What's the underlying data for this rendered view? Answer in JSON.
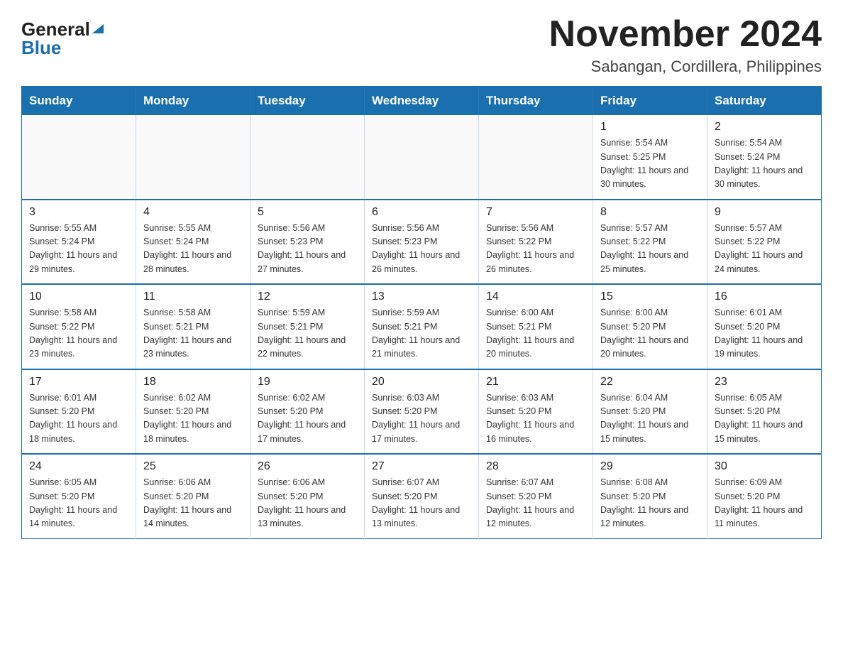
{
  "logo": {
    "general": "General",
    "blue": "Blue"
  },
  "header": {
    "month_year": "November 2024",
    "location": "Sabangan, Cordillera, Philippines"
  },
  "days_of_week": [
    "Sunday",
    "Monday",
    "Tuesday",
    "Wednesday",
    "Thursday",
    "Friday",
    "Saturday"
  ],
  "weeks": [
    [
      {
        "day": "",
        "info": ""
      },
      {
        "day": "",
        "info": ""
      },
      {
        "day": "",
        "info": ""
      },
      {
        "day": "",
        "info": ""
      },
      {
        "day": "",
        "info": ""
      },
      {
        "day": "1",
        "info": "Sunrise: 5:54 AM\nSunset: 5:25 PM\nDaylight: 11 hours and 30 minutes."
      },
      {
        "day": "2",
        "info": "Sunrise: 5:54 AM\nSunset: 5:24 PM\nDaylight: 11 hours and 30 minutes."
      }
    ],
    [
      {
        "day": "3",
        "info": "Sunrise: 5:55 AM\nSunset: 5:24 PM\nDaylight: 11 hours and 29 minutes."
      },
      {
        "day": "4",
        "info": "Sunrise: 5:55 AM\nSunset: 5:24 PM\nDaylight: 11 hours and 28 minutes."
      },
      {
        "day": "5",
        "info": "Sunrise: 5:56 AM\nSunset: 5:23 PM\nDaylight: 11 hours and 27 minutes."
      },
      {
        "day": "6",
        "info": "Sunrise: 5:56 AM\nSunset: 5:23 PM\nDaylight: 11 hours and 26 minutes."
      },
      {
        "day": "7",
        "info": "Sunrise: 5:56 AM\nSunset: 5:22 PM\nDaylight: 11 hours and 26 minutes."
      },
      {
        "day": "8",
        "info": "Sunrise: 5:57 AM\nSunset: 5:22 PM\nDaylight: 11 hours and 25 minutes."
      },
      {
        "day": "9",
        "info": "Sunrise: 5:57 AM\nSunset: 5:22 PM\nDaylight: 11 hours and 24 minutes."
      }
    ],
    [
      {
        "day": "10",
        "info": "Sunrise: 5:58 AM\nSunset: 5:22 PM\nDaylight: 11 hours and 23 minutes."
      },
      {
        "day": "11",
        "info": "Sunrise: 5:58 AM\nSunset: 5:21 PM\nDaylight: 11 hours and 23 minutes."
      },
      {
        "day": "12",
        "info": "Sunrise: 5:59 AM\nSunset: 5:21 PM\nDaylight: 11 hours and 22 minutes."
      },
      {
        "day": "13",
        "info": "Sunrise: 5:59 AM\nSunset: 5:21 PM\nDaylight: 11 hours and 21 minutes."
      },
      {
        "day": "14",
        "info": "Sunrise: 6:00 AM\nSunset: 5:21 PM\nDaylight: 11 hours and 20 minutes."
      },
      {
        "day": "15",
        "info": "Sunrise: 6:00 AM\nSunset: 5:20 PM\nDaylight: 11 hours and 20 minutes."
      },
      {
        "day": "16",
        "info": "Sunrise: 6:01 AM\nSunset: 5:20 PM\nDaylight: 11 hours and 19 minutes."
      }
    ],
    [
      {
        "day": "17",
        "info": "Sunrise: 6:01 AM\nSunset: 5:20 PM\nDaylight: 11 hours and 18 minutes."
      },
      {
        "day": "18",
        "info": "Sunrise: 6:02 AM\nSunset: 5:20 PM\nDaylight: 11 hours and 18 minutes."
      },
      {
        "day": "19",
        "info": "Sunrise: 6:02 AM\nSunset: 5:20 PM\nDaylight: 11 hours and 17 minutes."
      },
      {
        "day": "20",
        "info": "Sunrise: 6:03 AM\nSunset: 5:20 PM\nDaylight: 11 hours and 17 minutes."
      },
      {
        "day": "21",
        "info": "Sunrise: 6:03 AM\nSunset: 5:20 PM\nDaylight: 11 hours and 16 minutes."
      },
      {
        "day": "22",
        "info": "Sunrise: 6:04 AM\nSunset: 5:20 PM\nDaylight: 11 hours and 15 minutes."
      },
      {
        "day": "23",
        "info": "Sunrise: 6:05 AM\nSunset: 5:20 PM\nDaylight: 11 hours and 15 minutes."
      }
    ],
    [
      {
        "day": "24",
        "info": "Sunrise: 6:05 AM\nSunset: 5:20 PM\nDaylight: 11 hours and 14 minutes."
      },
      {
        "day": "25",
        "info": "Sunrise: 6:06 AM\nSunset: 5:20 PM\nDaylight: 11 hours and 14 minutes."
      },
      {
        "day": "26",
        "info": "Sunrise: 6:06 AM\nSunset: 5:20 PM\nDaylight: 11 hours and 13 minutes."
      },
      {
        "day": "27",
        "info": "Sunrise: 6:07 AM\nSunset: 5:20 PM\nDaylight: 11 hours and 13 minutes."
      },
      {
        "day": "28",
        "info": "Sunrise: 6:07 AM\nSunset: 5:20 PM\nDaylight: 11 hours and 12 minutes."
      },
      {
        "day": "29",
        "info": "Sunrise: 6:08 AM\nSunset: 5:20 PM\nDaylight: 11 hours and 12 minutes."
      },
      {
        "day": "30",
        "info": "Sunrise: 6:09 AM\nSunset: 5:20 PM\nDaylight: 11 hours and 11 minutes."
      }
    ]
  ]
}
